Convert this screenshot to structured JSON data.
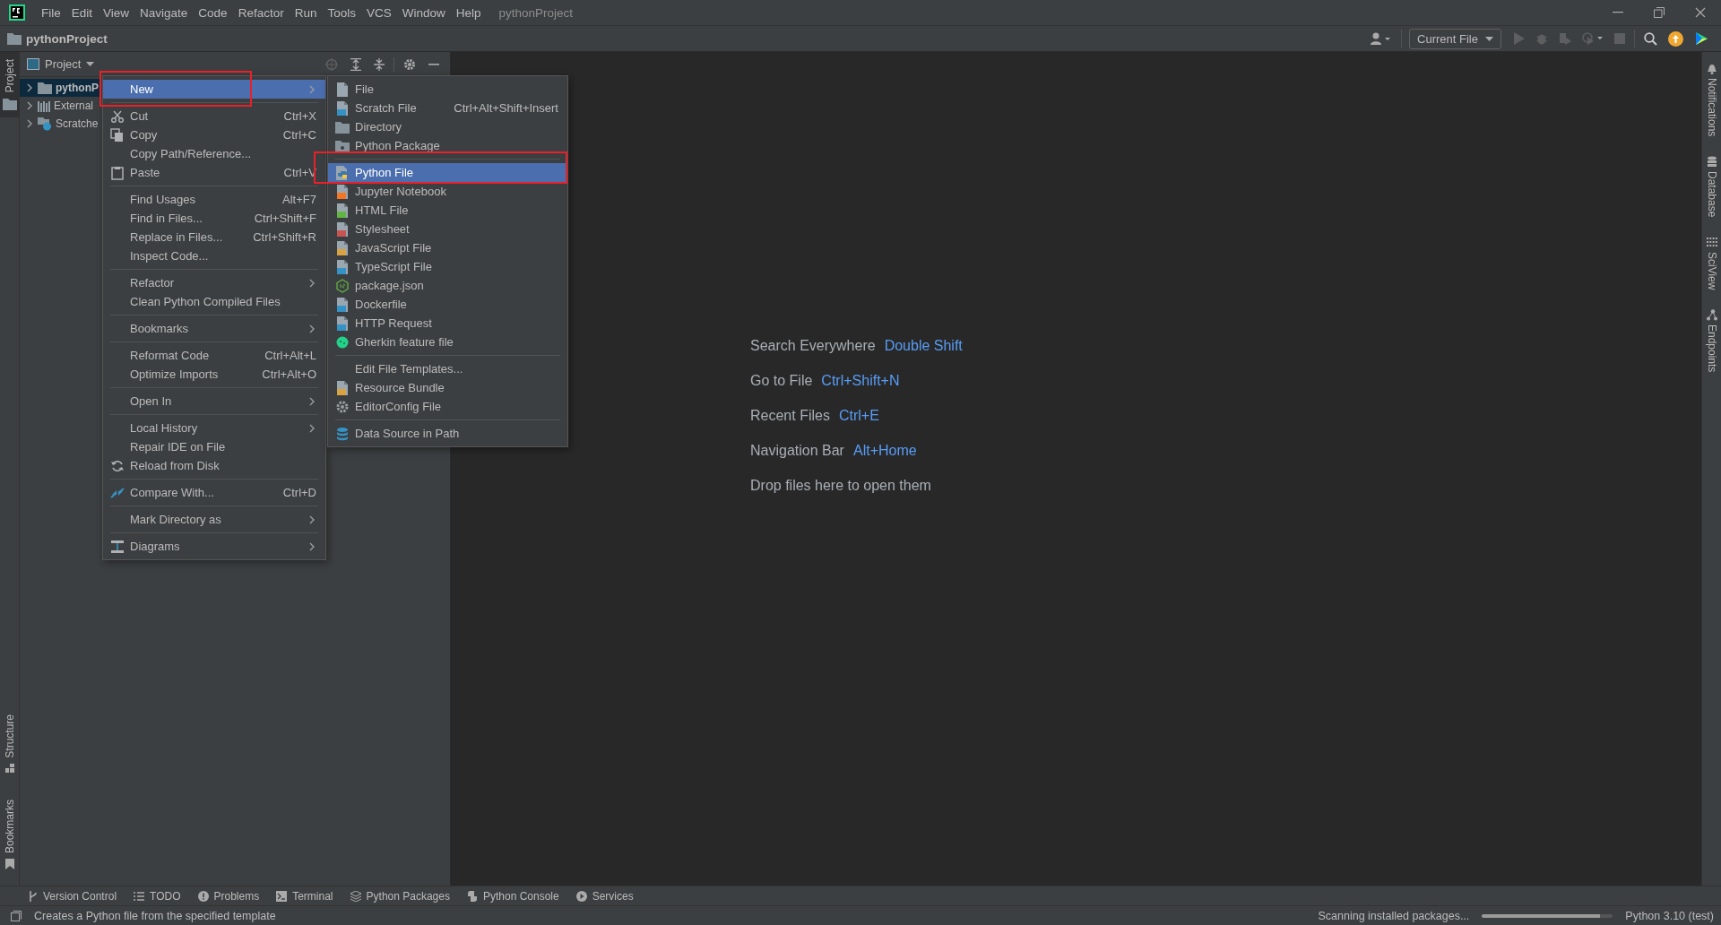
{
  "menu_bar": {
    "items": [
      "File",
      "Edit",
      "View",
      "Navigate",
      "Code",
      "Refactor",
      "Run",
      "Tools",
      "VCS",
      "Window",
      "Help"
    ],
    "project_title": "pythonProject"
  },
  "nav_bar": {
    "project": "pythonProject",
    "run_config": "Current File"
  },
  "left_strip": {
    "top": [
      {
        "label": "Project",
        "selected": true
      }
    ],
    "bottom": [
      {
        "label": "Structure",
        "selected": false
      },
      {
        "label": "Bookmarks",
        "selected": false
      }
    ]
  },
  "project_panel": {
    "title": "Project",
    "tree": [
      {
        "label": "pythonP",
        "expanded": false,
        "selected": true
      },
      {
        "label": "External",
        "expanded": false,
        "selected": false
      },
      {
        "label": "Scratche",
        "expanded": false,
        "selected": false
      }
    ]
  },
  "context_menu": {
    "items": [
      {
        "kind": "item",
        "label": "New",
        "submenu": true,
        "selected": true,
        "highlighted": true
      },
      {
        "kind": "separator"
      },
      {
        "kind": "item",
        "label": "Cut",
        "shortcut": "Ctrl+X",
        "selected": false
      },
      {
        "kind": "item",
        "label": "Copy",
        "shortcut": "Ctrl+C",
        "selected": false
      },
      {
        "kind": "item",
        "label": "Copy Path/Reference...",
        "selected": false
      },
      {
        "kind": "item",
        "label": "Paste",
        "shortcut": "Ctrl+V",
        "selected": false
      },
      {
        "kind": "separator"
      },
      {
        "kind": "item",
        "label": "Find Usages",
        "shortcut": "Alt+F7",
        "selected": false
      },
      {
        "kind": "item",
        "label": "Find in Files...",
        "shortcut": "Ctrl+Shift+F",
        "selected": false
      },
      {
        "kind": "item",
        "label": "Replace in Files...",
        "shortcut": "Ctrl+Shift+R",
        "selected": false
      },
      {
        "kind": "item",
        "label": "Inspect Code...",
        "selected": false
      },
      {
        "kind": "separator"
      },
      {
        "kind": "item",
        "label": "Refactor",
        "submenu": true,
        "selected": false
      },
      {
        "kind": "item",
        "label": "Clean Python Compiled Files",
        "selected": false
      },
      {
        "kind": "separator"
      },
      {
        "kind": "item",
        "label": "Bookmarks",
        "submenu": true,
        "selected": false
      },
      {
        "kind": "separator"
      },
      {
        "kind": "item",
        "label": "Reformat Code",
        "shortcut": "Ctrl+Alt+L",
        "selected": false
      },
      {
        "kind": "item",
        "label": "Optimize Imports",
        "shortcut": "Ctrl+Alt+O",
        "selected": false
      },
      {
        "kind": "separator"
      },
      {
        "kind": "item",
        "label": "Open In",
        "submenu": true,
        "selected": false
      },
      {
        "kind": "separator"
      },
      {
        "kind": "item",
        "label": "Local History",
        "submenu": true,
        "selected": false
      },
      {
        "kind": "item",
        "label": "Repair IDE on File",
        "selected": false
      },
      {
        "kind": "item",
        "label": "Reload from Disk",
        "selected": false
      },
      {
        "kind": "separator"
      },
      {
        "kind": "item",
        "label": "Compare With...",
        "shortcut": "Ctrl+D",
        "selected": false
      },
      {
        "kind": "separator"
      },
      {
        "kind": "item",
        "label": "Mark Directory as",
        "submenu": true,
        "selected": false
      },
      {
        "kind": "separator"
      },
      {
        "kind": "item",
        "label": "Diagrams",
        "submenu": true,
        "selected": false
      }
    ]
  },
  "new_submenu": {
    "items": [
      {
        "kind": "item",
        "label": "File",
        "selected": false
      },
      {
        "kind": "item",
        "label": "Scratch File",
        "shortcut": "Ctrl+Alt+Shift+Insert",
        "selected": false
      },
      {
        "kind": "item",
        "label": "Directory",
        "selected": false
      },
      {
        "kind": "item",
        "label": "Python Package",
        "selected": false
      },
      {
        "kind": "separator"
      },
      {
        "kind": "item",
        "label": "Python File",
        "selected": true,
        "highlighted": true
      },
      {
        "kind": "item",
        "label": "Jupyter Notebook",
        "selected": false
      },
      {
        "kind": "item",
        "label": "HTML File",
        "selected": false
      },
      {
        "kind": "item",
        "label": "Stylesheet",
        "selected": false
      },
      {
        "kind": "item",
        "label": "JavaScript File",
        "selected": false
      },
      {
        "kind": "item",
        "label": "TypeScript File",
        "selected": false
      },
      {
        "kind": "item",
        "label": "package.json",
        "selected": false
      },
      {
        "kind": "item",
        "label": "Dockerfile",
        "selected": false
      },
      {
        "kind": "item",
        "label": "HTTP Request",
        "selected": false
      },
      {
        "kind": "item",
        "label": "Gherkin feature file",
        "selected": false
      },
      {
        "kind": "separator"
      },
      {
        "kind": "item",
        "label": "Edit File Templates...",
        "selected": false
      },
      {
        "kind": "item",
        "label": "Resource Bundle",
        "selected": false
      },
      {
        "kind": "item",
        "label": "EditorConfig File",
        "selected": false
      },
      {
        "kind": "separator"
      },
      {
        "kind": "item",
        "label": "Data Source in Path",
        "selected": false
      }
    ]
  },
  "editor_hints": [
    {
      "label": "Search Everywhere",
      "shortcut": "Double Shift"
    },
    {
      "label": "Go to File",
      "shortcut": "Ctrl+Shift+N"
    },
    {
      "label": "Recent Files",
      "shortcut": "Ctrl+E"
    },
    {
      "label": "Navigation Bar",
      "shortcut": "Alt+Home"
    },
    {
      "label": "Drop files here to open them"
    }
  ],
  "right_strip": [
    {
      "label": "Notifications"
    },
    {
      "label": "Database"
    },
    {
      "label": "SciView"
    },
    {
      "label": "Endpoints"
    }
  ],
  "tool_tabs": [
    {
      "label": "Version Control"
    },
    {
      "label": "TODO"
    },
    {
      "label": "Problems"
    },
    {
      "label": "Terminal"
    },
    {
      "label": "Python Packages"
    },
    {
      "label": "Python Console"
    },
    {
      "label": "Services"
    }
  ],
  "status_bar": {
    "message": "Creates a Python file from the specified template",
    "task": "Scanning installed packages...",
    "level": 0.9,
    "interpreter": "Python 3.10 (test)"
  }
}
